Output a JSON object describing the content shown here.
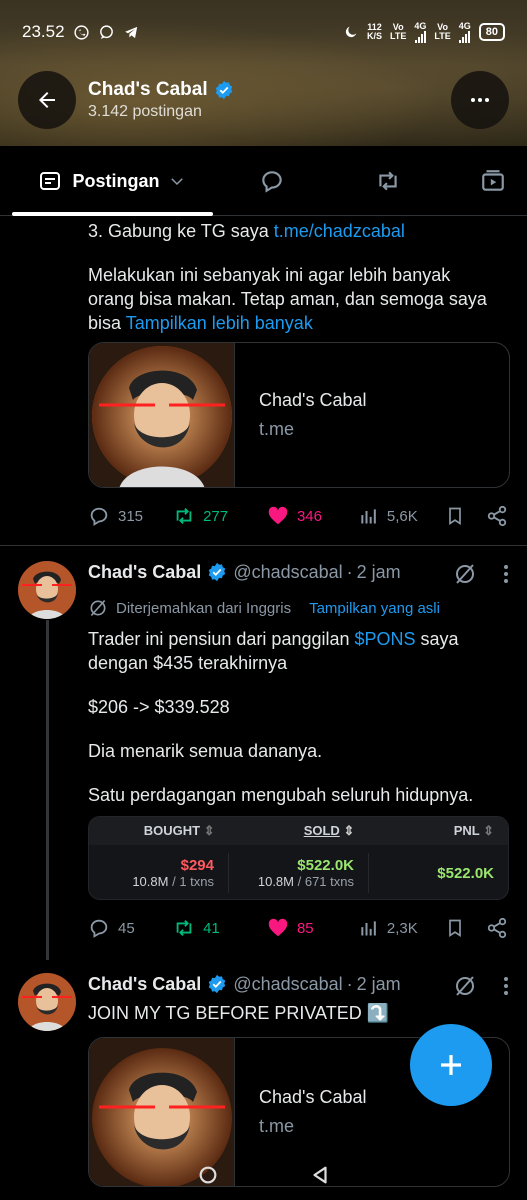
{
  "status_bar": {
    "time": "23.52",
    "net_speed_value": "112",
    "net_speed_unit": "K/S",
    "sim1_label_top": "Vo",
    "sim1_label_bottom": "LTE",
    "sim1_gen": "4G",
    "sim2_label_top": "Vo",
    "sim2_label_bottom": "LTE",
    "sim2_gen": "4G",
    "battery": "80"
  },
  "header": {
    "name": "Chad's Cabal",
    "posts": "3.142 postingan"
  },
  "tabs": {
    "active_label": "Postingan"
  },
  "tweet1": {
    "line_partial": "3. Gabung ke TG saya ",
    "line_link": "t.me/chadzcabal",
    "para_line1": "Melakukan ini sebanyak ini agar lebih banyak",
    "para_line2": "orang bisa makan. Tetap aman, dan semoga saya",
    "para_line3": "bisa ",
    "show_more": "Tampilkan lebih banyak",
    "card_title": "Chad's Cabal",
    "card_domain": "t.me",
    "replies": "315",
    "retweets": "277",
    "likes": "346",
    "views": "5,6K"
  },
  "tweet2": {
    "name": "Chad's Cabal",
    "handle": "@chadscabal",
    "sep": "·",
    "time": "2 jam",
    "translated_from": "Diterjemahkan dari Inggris",
    "show_original": "Tampilkan yang asli",
    "line1_pre": "Trader ini pensiun dari panggilan ",
    "line1_ticker": "$PONS",
    "line1_post": " saya",
    "line2": "dengan $435 terakhirnya",
    "line3": "$206 -> $339.528",
    "line4": "Dia menarik semua dananya.",
    "line5": "Satu perdagangan mengubah seluruh hidupnya.",
    "trade": {
      "headers": [
        "BOUGHT",
        "SOLD",
        "PNL"
      ],
      "bought_value": "$294",
      "bought_tokens": "10.8M",
      "bought_txns": "1 txns",
      "sold_value": "$522.0K",
      "sold_tokens": "10.8M",
      "sold_txns": "671 txns",
      "pnl": "$522.0K"
    },
    "replies": "45",
    "retweets": "41",
    "likes": "85",
    "views": "2,3K"
  },
  "tweet3": {
    "name": "Chad's Cabal",
    "handle": "@chadscabal",
    "sep": "·",
    "time": "2 jam",
    "text": "JOIN MY TG BEFORE PRIVATED ⤵️",
    "card_title": "Chad's Cabal",
    "card_domain": "t.me"
  },
  "colors": {
    "accent": "#1d9bf0",
    "retweet": "#00ba7c",
    "like": "#f91880"
  }
}
